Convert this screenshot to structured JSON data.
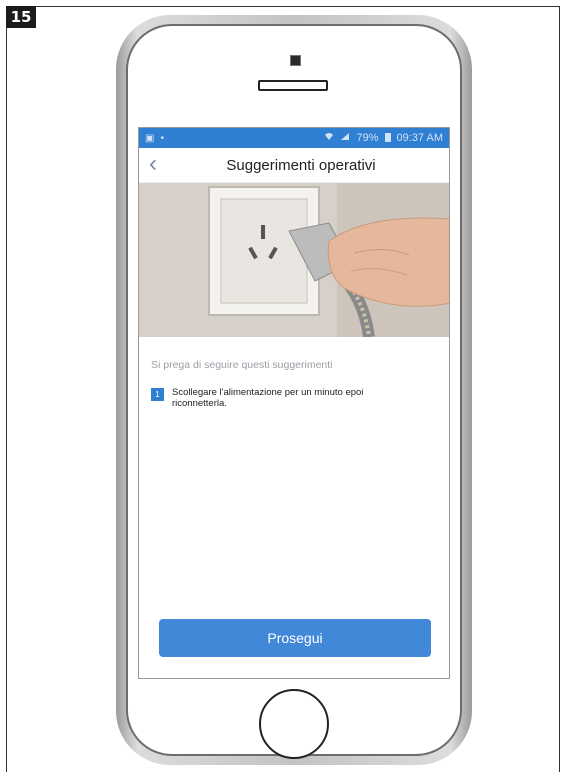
{
  "step": {
    "number": "15"
  },
  "status_bar": {
    "time": "09:37 AM",
    "battery": "79%",
    "left_icons": [
      "gallery-icon",
      "dot-icon"
    ],
    "right_icons": [
      "wifi-icon",
      "signal-icon",
      "battery-icon"
    ]
  },
  "header": {
    "title": "Suggerimenti operativi",
    "back_icon": "chevron-left-icon"
  },
  "content": {
    "message": "Si prega di seguire questi suggerimenti",
    "tips": [
      {
        "number": "1",
        "text": "Scollegare l'alimentazione per un minuto epoi riconnetterla."
      }
    ]
  },
  "actions": {
    "continue_label": "Prosegui"
  },
  "colors": {
    "primary": "#2f7fd3",
    "button": "#4288d8",
    "text_dark": "#222222",
    "text_light": "#9aa0a6"
  }
}
